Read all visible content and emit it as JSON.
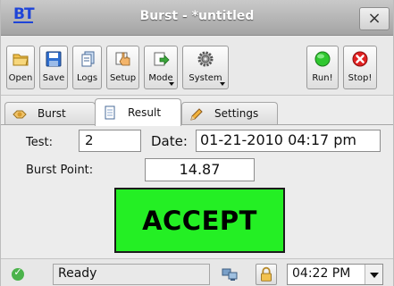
{
  "window": {
    "logo_text": "BT",
    "title": "Burst - *untitled",
    "close_label": "×"
  },
  "toolbar": {
    "buttons": [
      {
        "label": "Open",
        "icon": "folder-open-icon"
      },
      {
        "label": "Save",
        "icon": "floppy-disk-icon"
      },
      {
        "label": "Logs",
        "icon": "documents-icon"
      },
      {
        "label": "Setup",
        "icon": "hand-pointer-icon"
      },
      {
        "label": "Mode",
        "icon": "mode-arrow-icon",
        "has_menu": true
      },
      {
        "label": "System",
        "icon": "gear-icon",
        "has_menu": true
      },
      {
        "label": "Run!",
        "icon": "green-circle-icon"
      },
      {
        "label": "Stop!",
        "icon": "red-stop-icon"
      }
    ]
  },
  "tabs": [
    {
      "label": "Burst",
      "icon": "burst-icon",
      "active": false
    },
    {
      "label": "Result",
      "icon": "page-icon",
      "active": true
    },
    {
      "label": "Settings",
      "icon": "pencil-icon",
      "active": false
    }
  ],
  "result": {
    "test_label": "Test:",
    "test_value": "2",
    "date_label": "Date:",
    "date_value": "01-21-2010 04:17 pm",
    "burst_point_label": "Burst Point:",
    "burst_point_value": "14.87",
    "verdict": "ACCEPT",
    "verdict_color": "#24ef24"
  },
  "statusbar": {
    "status": "Ready",
    "status_icon": "check-circle-icon",
    "time": "04:22 PM"
  },
  "colors": {
    "accent_logo": "#1e44d8",
    "run_green": "#2fc72f",
    "stop_red": "#e02020"
  }
}
